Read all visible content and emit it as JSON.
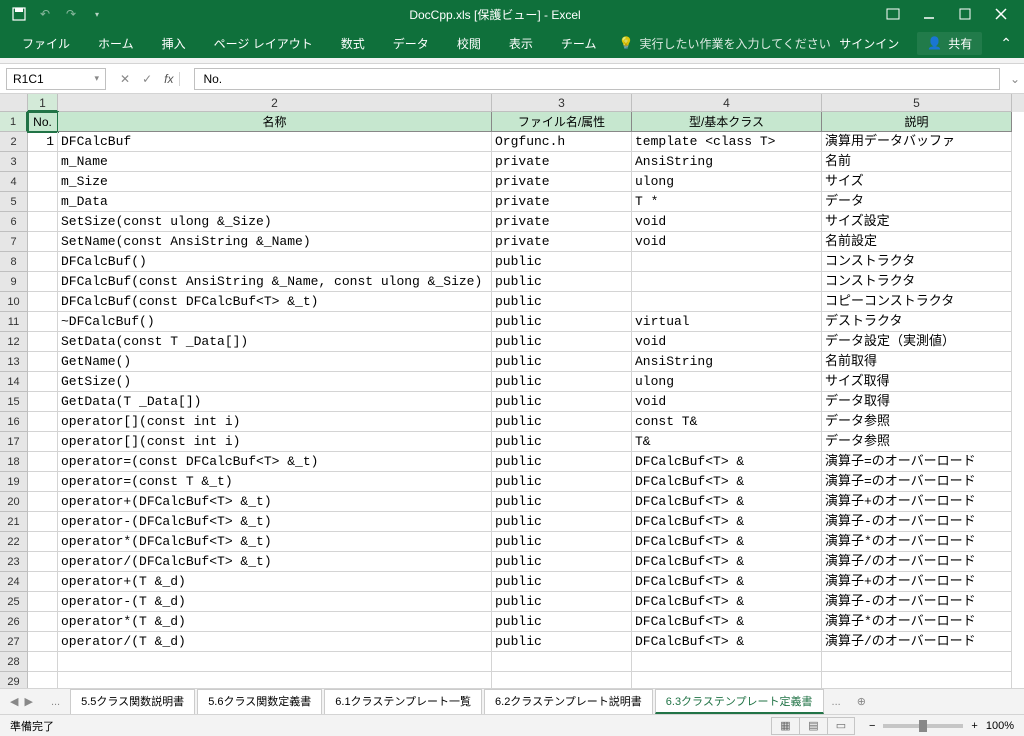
{
  "title": "DocCpp.xls [保護ビュー] - Excel",
  "qat": {
    "undo": "↶",
    "redo": "↷"
  },
  "ribbon": {
    "tabs": [
      "ファイル",
      "ホーム",
      "挿入",
      "ページ レイアウト",
      "数式",
      "データ",
      "校閲",
      "表示",
      "チーム"
    ],
    "tellme": "実行したい作業を入力してください",
    "signin": "サインイン",
    "share": "共有"
  },
  "namebox": "R1C1",
  "formula": "No.",
  "colnums": [
    "1",
    "2",
    "3",
    "4",
    "5"
  ],
  "headers": {
    "c1": "No.",
    "c2": "名称",
    "c3": "ファイル名/属性",
    "c4": "型/基本クラス",
    "c5": "説明"
  },
  "rows": [
    {
      "n": "1",
      "name": "DFCalcBuf",
      "attr": "Orgfunc.h",
      "type": "template <class T>",
      "desc": "演算用データバッファ"
    },
    {
      "n": "",
      "name": "m_Name",
      "attr": "private",
      "type": "AnsiString",
      "desc": "名前"
    },
    {
      "n": "",
      "name": "m_Size",
      "attr": "private",
      "type": "ulong",
      "desc": "サイズ"
    },
    {
      "n": "",
      "name": "m_Data",
      "attr": "private",
      "type": "T *",
      "desc": "データ"
    },
    {
      "n": "",
      "name": "SetSize(const ulong &_Size)",
      "attr": "private",
      "type": "void",
      "desc": "サイズ設定"
    },
    {
      "n": "",
      "name": "SetName(const AnsiString &_Name)",
      "attr": "private",
      "type": "void",
      "desc": "名前設定"
    },
    {
      "n": "",
      "name": "DFCalcBuf()",
      "attr": "public",
      "type": "",
      "desc": "コンストラクタ"
    },
    {
      "n": "",
      "name": "DFCalcBuf(const AnsiString &_Name, const ulong &_Size)",
      "attr": "public",
      "type": "",
      "desc": "コンストラクタ"
    },
    {
      "n": "",
      "name": "DFCalcBuf(const DFCalcBuf<T> &_t)",
      "attr": "public",
      "type": "",
      "desc": "コピーコンストラクタ"
    },
    {
      "n": "",
      "name": "~DFCalcBuf()",
      "attr": "public",
      "type": "virtual",
      "desc": "デストラクタ"
    },
    {
      "n": "",
      "name": "SetData(const T _Data[])",
      "attr": "public",
      "type": "void",
      "desc": "データ設定（実測値）"
    },
    {
      "n": "",
      "name": "GetName()",
      "attr": "public",
      "type": "AnsiString",
      "desc": "名前取得"
    },
    {
      "n": "",
      "name": "GetSize()",
      "attr": "public",
      "type": "ulong",
      "desc": "サイズ取得"
    },
    {
      "n": "",
      "name": "GetData(T _Data[])",
      "attr": "public",
      "type": "void",
      "desc": "データ取得"
    },
    {
      "n": "",
      "name": "operator[](const int i)",
      "attr": "public",
      "type": "const T&",
      "desc": "データ参照"
    },
    {
      "n": "",
      "name": "operator[](const int i)",
      "attr": "public",
      "type": "T&",
      "desc": "データ参照"
    },
    {
      "n": "",
      "name": "operator=(const DFCalcBuf<T> &_t)",
      "attr": "public",
      "type": "DFCalcBuf<T> &",
      "desc": "演算子=のオーバーロード"
    },
    {
      "n": "",
      "name": "operator=(const T &_t)",
      "attr": "public",
      "type": "DFCalcBuf<T> &",
      "desc": "演算子=のオーバーロード"
    },
    {
      "n": "",
      "name": "operator+(DFCalcBuf<T> &_t)",
      "attr": "public",
      "type": "DFCalcBuf<T> &",
      "desc": "演算子+のオーバーロード"
    },
    {
      "n": "",
      "name": "operator-(DFCalcBuf<T> &_t)",
      "attr": "public",
      "type": "DFCalcBuf<T> &",
      "desc": "演算子-のオーバーロード"
    },
    {
      "n": "",
      "name": "operator*(DFCalcBuf<T> &_t)",
      "attr": "public",
      "type": "DFCalcBuf<T> &",
      "desc": "演算子*のオーバーロード"
    },
    {
      "n": "",
      "name": "operator/(DFCalcBuf<T> &_t)",
      "attr": "public",
      "type": "DFCalcBuf<T> &",
      "desc": "演算子/のオーバーロード"
    },
    {
      "n": "",
      "name": "operator+(T &_d)",
      "attr": "public",
      "type": "DFCalcBuf<T> &",
      "desc": "演算子+のオーバーロード"
    },
    {
      "n": "",
      "name": "operator-(T &_d)",
      "attr": "public",
      "type": "DFCalcBuf<T> &",
      "desc": "演算子-のオーバーロード"
    },
    {
      "n": "",
      "name": "operator*(T &_d)",
      "attr": "public",
      "type": "DFCalcBuf<T> &",
      "desc": "演算子*のオーバーロード"
    },
    {
      "n": "",
      "name": "operator/(T &_d)",
      "attr": "public",
      "type": "DFCalcBuf<T> &",
      "desc": "演算子/のオーバーロード"
    }
  ],
  "sheetTabs": [
    "5.5クラス関数説明書",
    "5.6クラス関数定義書",
    "6.1クラステンプレート一覧",
    "6.2クラステンプレート説明書",
    "6.3クラステンプレート定義書"
  ],
  "activeTab": 4,
  "moreTabs": "...",
  "status": {
    "ready": "準備完了",
    "zoom": "100%"
  }
}
